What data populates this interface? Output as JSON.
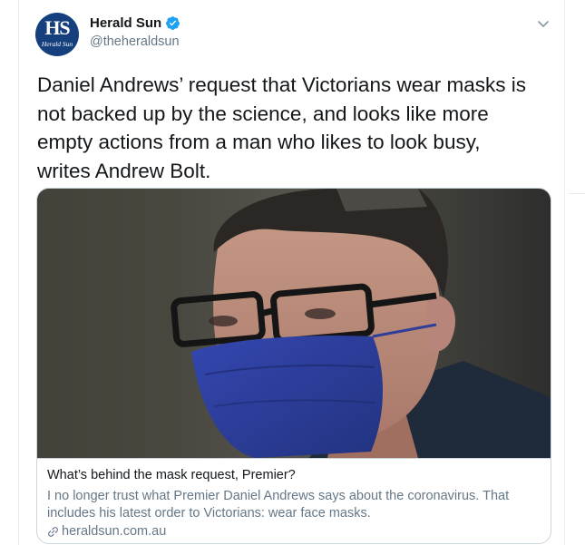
{
  "account": {
    "display_name": "Herald Sun",
    "handle": "@theheraldsun",
    "avatar_text": "HS",
    "avatar_subtext": "Herald Sun",
    "verified": true
  },
  "tweet": {
    "lines": [
      "Daniel Andrews’ request that Victorians wear masks is",
      "not backed up by the science, and looks like more",
      "empty actions from a man who likes to look busy,",
      "writes Andrew Bolt."
    ]
  },
  "card": {
    "title": "What’s behind the mask request, Premier?",
    "description_lines": [
      "I no longer trust what Premier Daniel Andrews says about the coronavirus. That",
      "includes his latest order to Victorians: wear face masks."
    ],
    "domain": "heraldsun.com.au"
  },
  "icons": {
    "verified": "verified-badge-icon",
    "caret": "chevron-down-icon",
    "link": "link-icon"
  },
  "colors": {
    "brand_blue": "#1da1f2",
    "avatar_bg": "#153f7d",
    "text": "#14171a",
    "secondary": "#657786",
    "border": "#ccd6dd",
    "mask": "#2b3f9e"
  }
}
